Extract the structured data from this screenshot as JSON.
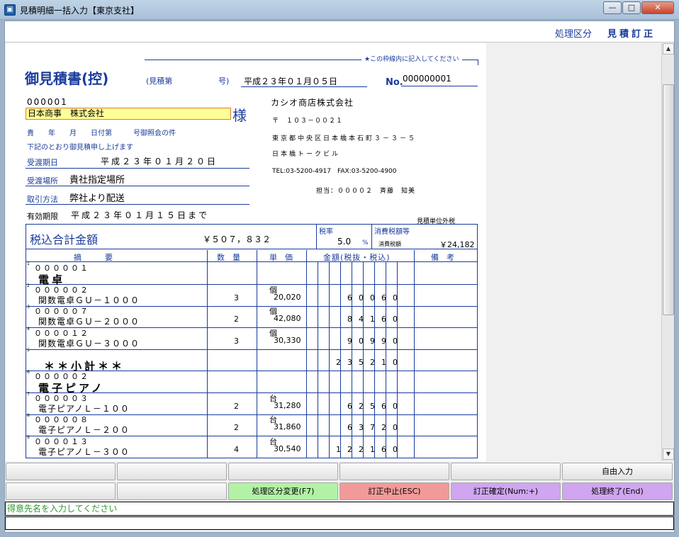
{
  "window": {
    "title": "見積明細一括入力【東京支社】",
    "minimize": "—",
    "maximize": "□",
    "close": "✕"
  },
  "mode": {
    "label": "処理区分",
    "value": "見積訂正"
  },
  "doc": {
    "title": "御見積書(控)",
    "mitsumori_label": "(見積第",
    "go_label": "号)",
    "date": "平成２３年０１月０５日",
    "no_label": "No.",
    "no_value": "000000001",
    "notice": "★この枠線内に記入してください",
    "customer_code": "000001",
    "customer_name": "日本商事　株式会社",
    "sama": "様",
    "ref_line": "貴　　年　　月　　日付第　　　号御照会の件",
    "greeting": "下記のとおり御見積申し上げます",
    "delivery_label": "受渡期日",
    "delivery_value": "平成２３年０１月２０日",
    "place_label": "受渡場所",
    "place_value": "貴社指定場所",
    "method_label": "取引方法",
    "method_value": "弊社より配送",
    "valid_label": "有効期限",
    "valid_value": "平成２３年０１月１５日まで",
    "company": {
      "name": "カシオ商店株式会社",
      "zip": "〒　１０３－００２１",
      "addr1": "東京都中央区日本橋本石町３－３－５",
      "addr2": "日本橋トークビル",
      "tel": "TEL:03-5200-4917　FAX:03-5200-4900",
      "staff": "担当：００００２　斉藤　知美"
    },
    "unit_note": "見積単位外税",
    "total_label": "税込合計金額",
    "total_value": "￥５０７，８３２",
    "tax_rate_label": "税率",
    "tax_rate_value": "5.0",
    "percent": "%",
    "tax_label": "消費税額等",
    "tax_sub_label": "消費税額",
    "tax_value": "￥24,182",
    "headers": {
      "tekiyo": "摘　　　要",
      "qty": "数　量",
      "price": "単　価",
      "amount": "金額(税抜・税込)",
      "remarks": "備　考"
    },
    "rows": [
      {
        "side": "05",
        "code": "０００００１",
        "name": "電卓",
        "qty": "",
        "unit": "",
        "price": "",
        "digits": [
          "",
          "",
          "",
          "",
          "",
          "",
          "",
          ""
        ]
      },
      {
        "side": "01",
        "code": "０００００２",
        "name": "関数電卓ＧＵ－１０００",
        "qty": "3",
        "unit": "個",
        "price": "20,020",
        "digits": [
          "",
          "",
          "",
          "6",
          "0",
          "0",
          "6",
          "0"
        ]
      },
      {
        "side": "01",
        "code": "０００００７",
        "name": "関数電卓ＧＵ－２０００",
        "qty": "2",
        "unit": "個",
        "price": "42,080",
        "digits": [
          "",
          "",
          "",
          "8",
          "4",
          "1",
          "6",
          "0"
        ]
      },
      {
        "side": "01",
        "code": "００００１２",
        "name": "関数電卓ＧＵ－３０００",
        "qty": "3",
        "unit": "個",
        "price": "30,330",
        "digits": [
          "",
          "",
          "",
          "9",
          "0",
          "9",
          "9",
          "0"
        ]
      },
      {
        "side": "06",
        "code": "",
        "name": "＊＊小計＊＊",
        "qty": "",
        "unit": "",
        "price": "",
        "digits": [
          "",
          "",
          "2",
          "3",
          "5",
          "2",
          "1",
          "0"
        ]
      },
      {
        "side": "05",
        "code": "０００００２",
        "name": "電子ピアノ",
        "qty": "",
        "unit": "",
        "price": "",
        "digits": [
          "",
          "",
          "",
          "",
          "",
          "",
          "",
          ""
        ]
      },
      {
        "side": "01",
        "code": "０００００３",
        "name": "電子ピアノＬ－１００",
        "qty": "2",
        "unit": "台",
        "price": "31,280",
        "digits": [
          "",
          "",
          "",
          "6",
          "2",
          "5",
          "6",
          "0"
        ]
      },
      {
        "side": "01",
        "code": "０００００８",
        "name": "電子ピアノＬ－２００",
        "qty": "2",
        "unit": "台",
        "price": "31,860",
        "digits": [
          "",
          "",
          "",
          "6",
          "3",
          "7",
          "2",
          "0"
        ]
      },
      {
        "side": "01",
        "code": "００００１３",
        "name": "電子ピアノＬ－３００",
        "qty": "4",
        "unit": "台",
        "price": "30,540",
        "digits": [
          "",
          "",
          "1",
          "2",
          "2",
          "1",
          "6",
          "0"
        ]
      }
    ]
  },
  "fkeys": {
    "row1": [
      "",
      "",
      "",
      "",
      "",
      "自由入力"
    ],
    "row2": [
      "",
      "",
      "処理区分変更(F7)",
      "訂正中止(ESC)",
      "訂正確定(Num:+)",
      "処理終了(End)"
    ]
  },
  "colors": {
    "f7": "#b3f2a6",
    "esc": "#f29a9a",
    "confirm": "#cfa6ef",
    "end": "#cfa6ef",
    "ink": "#1a3c9c"
  },
  "status": "得意先名を入力してください"
}
